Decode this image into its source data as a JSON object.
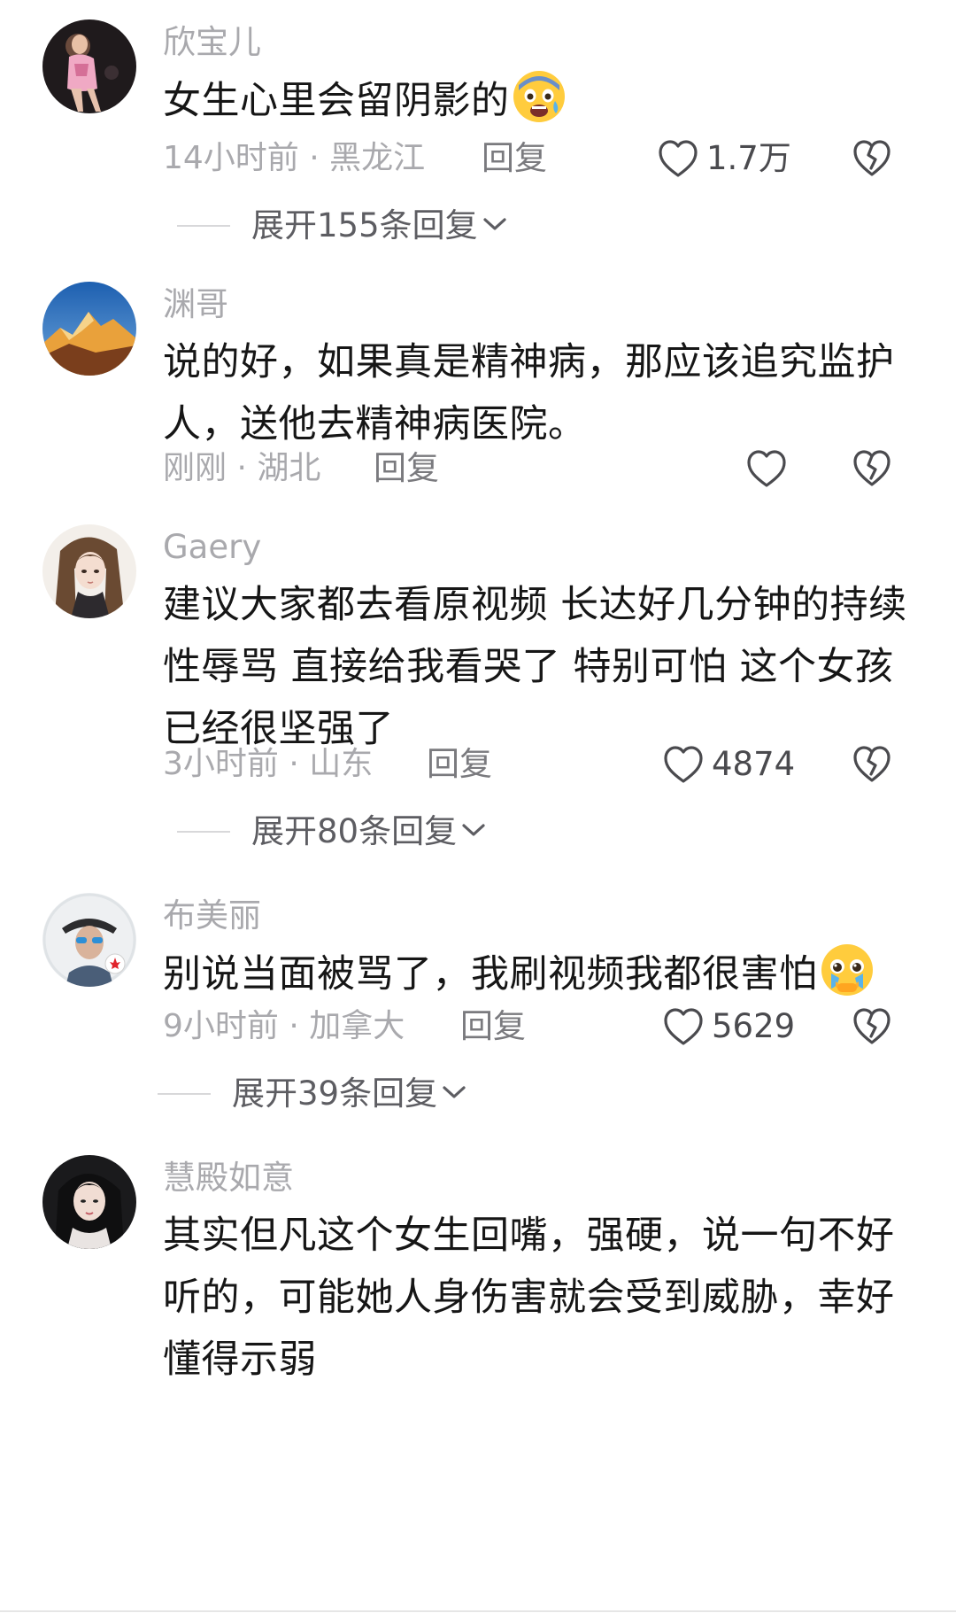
{
  "comments": [
    {
      "username": "欣宝儿",
      "text": "女生心里会留阴影的",
      "emoji": "fearful-face-emoji",
      "time_location": "14小时前 · 黑龙江",
      "reply_label": "回复",
      "likes": "1.7万",
      "expand_label": "展开155条回复"
    },
    {
      "username": "渊哥",
      "text": "说的好，如果真是精神病，那应该追究监护人，送他去精神病医院。",
      "time_location": "刚刚 · 湖北",
      "reply_label": "回复",
      "likes": ""
    },
    {
      "username": "Gaery",
      "text": "建议大家都去看原视频 长达好几分钟的持续性辱骂 直接给我看哭了 特别可怕 这个女孩已经很坚强了",
      "time_location": "3小时前 · 山东",
      "reply_label": "回复",
      "likes": "4874",
      "expand_label": "展开80条回复"
    },
    {
      "username": "布美丽",
      "text": "别说当面被骂了，我刷视频我都很害怕",
      "emoji": "pleading-crying-face-emoji",
      "time_location": "9小时前 · 加拿大",
      "reply_label": "回复",
      "likes": "5629",
      "expand_label": "展开39条回复"
    },
    {
      "username": "慧殿如意",
      "text": "其实但凡这个女生回嘴，强硬，说一句不好听的，可能她人身伤害就会受到威胁，幸好懂得示弱"
    }
  ],
  "icons": {
    "like": "heart-outline-icon",
    "dislike": "broken-heart-outline-icon",
    "expand": "chevron-down-icon"
  },
  "colors": {
    "username": "#a9a9ad",
    "text": "#161616",
    "meta": "#a9a9ad",
    "reply": "#7a7a7e"
  }
}
